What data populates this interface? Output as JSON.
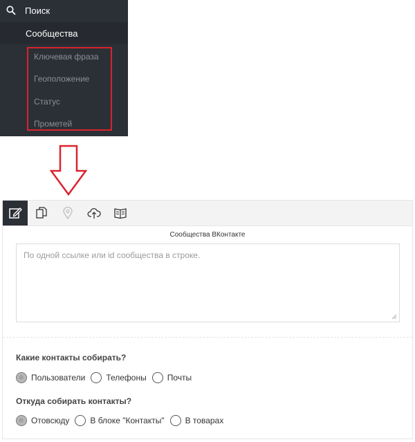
{
  "sidebar": {
    "search_label": "Поиск",
    "communities_label": "Сообщества",
    "submenu": [
      {
        "label": "Ключевая фраза"
      },
      {
        "label": "Геоположение"
      },
      {
        "label": "Статус"
      },
      {
        "label": "Прометей"
      }
    ],
    "highlight_color": "#d9232e"
  },
  "arrow": {
    "icon": "down-arrow-icon",
    "color": "#d9232e"
  },
  "toolbar": {
    "buttons": [
      {
        "icon": "edit-icon",
        "active": true
      },
      {
        "icon": "copy-icon",
        "active": false
      },
      {
        "icon": "location-pin-icon",
        "active": false
      },
      {
        "icon": "cloud-upload-icon",
        "active": false
      },
      {
        "icon": "book-icon",
        "active": false
      }
    ]
  },
  "form": {
    "field_caption": "Сообщества ВКонтакте",
    "textarea_placeholder": "По одной ссылке или id сообщества в строке.",
    "question1": "Какие контакты собирать?",
    "options1": [
      {
        "label": "Пользователи",
        "checked": true
      },
      {
        "label": "Телефоны",
        "checked": false
      },
      {
        "label": "Почты",
        "checked": false
      }
    ],
    "question2": "Откуда собирать контакты?",
    "options2": [
      {
        "label": "Отовсюду",
        "checked": true
      },
      {
        "label": "В блоке \"Контакты\"",
        "checked": false
      },
      {
        "label": "В товарах",
        "checked": false
      }
    ]
  }
}
